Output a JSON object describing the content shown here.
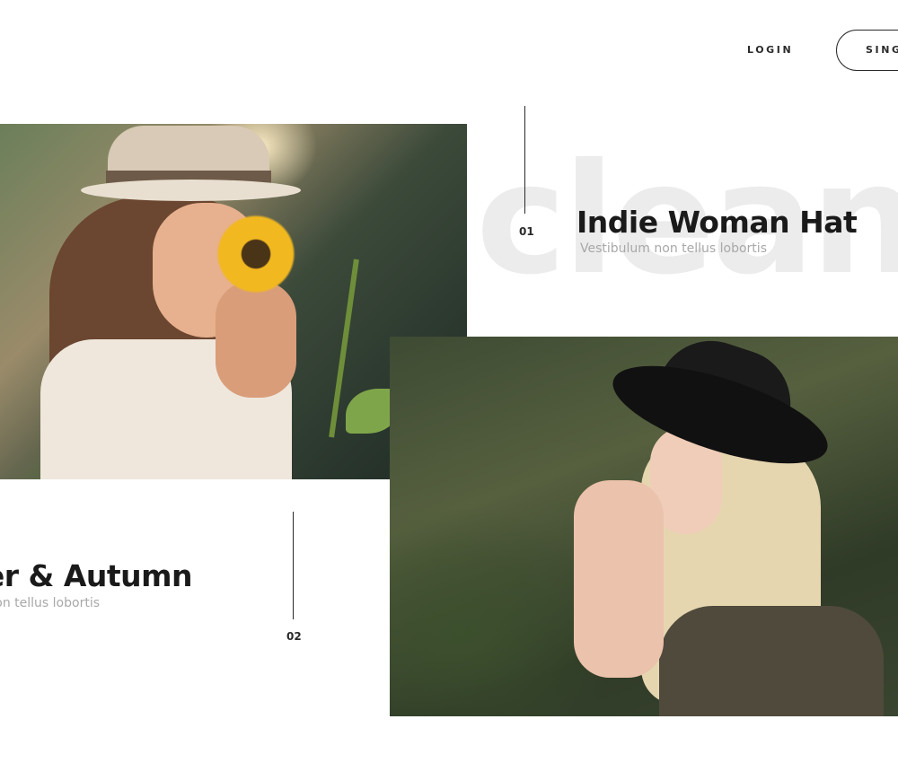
{
  "header": {
    "login_label": "LOGIN",
    "signup_label": "SINGUP"
  },
  "watermark": {
    "text": "clean s"
  },
  "features": [
    {
      "number": "01",
      "title": "Indie Woman Hat",
      "subtitle": "Vestibulum non tellus lobortis"
    },
    {
      "number": "02",
      "title": "Summer & Autumn",
      "subtitle": "Vestibulum non tellus lobortis"
    }
  ],
  "colors": {
    "text_dark": "#1a1a1a",
    "text_muted": "#a8a8a8",
    "watermark": "#ececec",
    "background": "#ffffff"
  }
}
